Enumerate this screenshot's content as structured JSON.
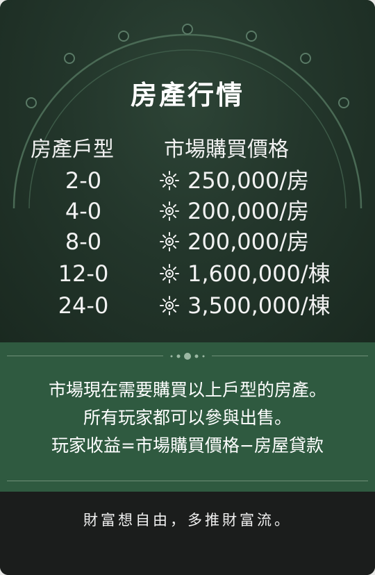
{
  "card": {
    "title": "房產行情",
    "col_type_header": "房產戶型",
    "col_price_header": "市場購買價格",
    "rows": [
      {
        "type": "2-0",
        "price": "250,000/房"
      },
      {
        "type": "4-0",
        "price": "200,000/房"
      },
      {
        "type": "8-0",
        "price": "200,000/房"
      },
      {
        "type": "12-0",
        "price": "1,600,000/棟"
      },
      {
        "type": "24-0",
        "price": "3,500,000/棟"
      }
    ],
    "info_lines": [
      "市場現在需要購買以上戶型的房產。",
      "所有玩家都可以參與出售。",
      "玩家收益=市場購買價格−房屋貸款"
    ],
    "slogan": "財富想自由，多推財富流。",
    "currency_icon": "sun-icon",
    "colors": {
      "top_bg": "#23362b",
      "band_bg": "#2f5a40",
      "bottom_bg": "#1b1d1c",
      "text": "#f2f2f2"
    }
  }
}
